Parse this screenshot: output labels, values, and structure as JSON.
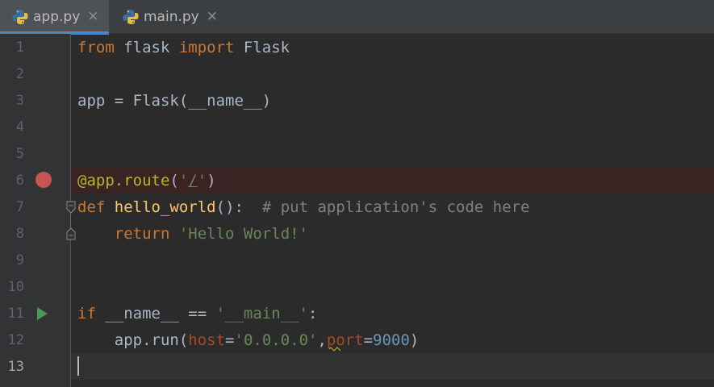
{
  "tabs": [
    {
      "label": "app.py",
      "close": "✕",
      "active": true
    },
    {
      "label": "main.py",
      "close": "✕",
      "active": false
    }
  ],
  "gutter": {
    "line_numbers": [
      "1",
      "2",
      "3",
      "4",
      "5",
      "6",
      "7",
      "8",
      "9",
      "10",
      "11",
      "12",
      "13"
    ],
    "current_line": 13,
    "breakpoint_line": 6,
    "run_line": 11
  },
  "code": {
    "l1": {
      "kw1": "from",
      "t1": " flask ",
      "kw2": "import",
      "t2": " Flask"
    },
    "l3": {
      "t": "app = Flask(__name__)"
    },
    "l6": {
      "deco": "@app.route",
      "p1": "(",
      "s1": "'",
      "s2": "/",
      "s3": "'",
      "p2": ")"
    },
    "l7": {
      "kw": "def",
      "sp": " ",
      "fn": "hello_world",
      "t": "():  ",
      "cmt": "# put application's code here"
    },
    "l8": {
      "ind": "    ",
      "kw": "return",
      "sp": " ",
      "str": "'Hello World!'"
    },
    "l11": {
      "kw": "if",
      "t": " __name__ == ",
      "str": "'__main__'",
      "t2": ":"
    },
    "l12": {
      "ind": "    ",
      "t1": "app.run(",
      "p1": "host",
      "eq1": "=",
      "s1": "'0.0.0.0'",
      "comma": ",",
      "p2": "port",
      "eq2": "=",
      "n": "9000",
      "t2": ")"
    }
  },
  "colors": {
    "keyword": "#cc7832",
    "string": "#6a8759",
    "decorator": "#bbb529",
    "function": "#ffc66d",
    "comment": "#808080",
    "number": "#6897bb",
    "param": "#aa4926",
    "breakpoint": "#c75450",
    "run": "#499c54",
    "tab_accent": "#4a88c7"
  }
}
